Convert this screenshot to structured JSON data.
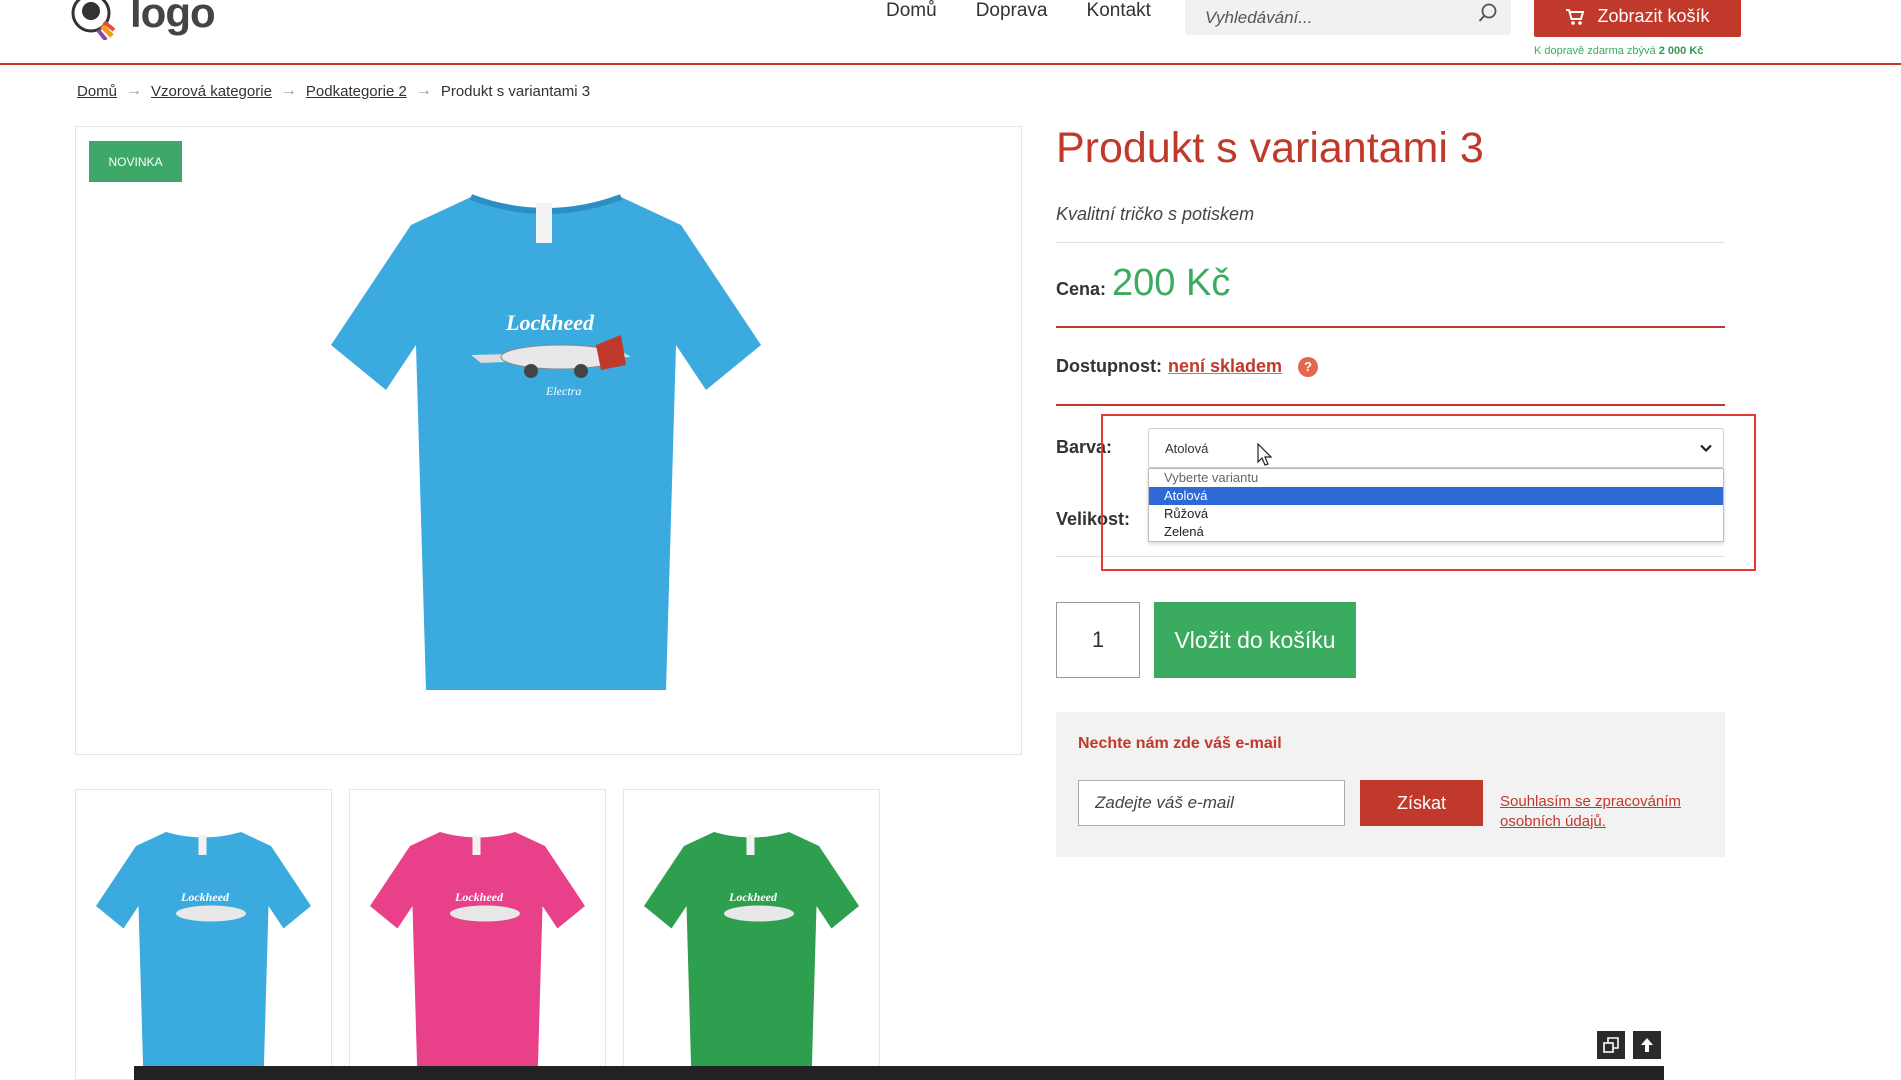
{
  "header": {
    "logo_text": "logo",
    "nav": [
      "Domů",
      "Doprava",
      "Kontakt"
    ],
    "search_placeholder": "Vyhledávání...",
    "cart_label": "Zobrazit košík",
    "free_shipping_text": "K dopravě zdarma zbývá",
    "free_shipping_amount": "2 000 Kč"
  },
  "breadcrumb": {
    "items": [
      "Domů",
      "Vzorová kategorie",
      "Podkategorie 2"
    ],
    "current": "Produkt s variantami 3"
  },
  "gallery": {
    "badge": "NOVINKA",
    "main_color": "#3aaadf",
    "thumbnails": [
      {
        "color": "#3aaadf"
      },
      {
        "color": "#e8418a"
      },
      {
        "color": "#2e9f4e"
      }
    ]
  },
  "product": {
    "title": "Produkt s variantami 3",
    "subtitle": "Kvalitní tričko s potiskem",
    "price_label": "Cena:",
    "price_value": "200 Kč",
    "availability_label": "Dostupnost:",
    "availability_value": "není skladem",
    "help_icon": "?",
    "color_label": "Barva:",
    "size_label": "Velikost:",
    "color_selected": "Atolová",
    "color_options": [
      "Vyberte variantu",
      "Atolová",
      "Růžová",
      "Zelená"
    ],
    "quantity": "1",
    "add_to_cart_label": "Vložit do košíku"
  },
  "email_signup": {
    "title": "Nechte nám zde váš e-mail",
    "placeholder": "Zadejte váš e-mail",
    "button_label": "Získat",
    "consent_text": "Souhlasím se zpracováním osobních údajů."
  },
  "colors": {
    "accent_red": "#c0392b",
    "accent_green": "#3aab5f",
    "select_highlight": "#2d6ad6"
  }
}
